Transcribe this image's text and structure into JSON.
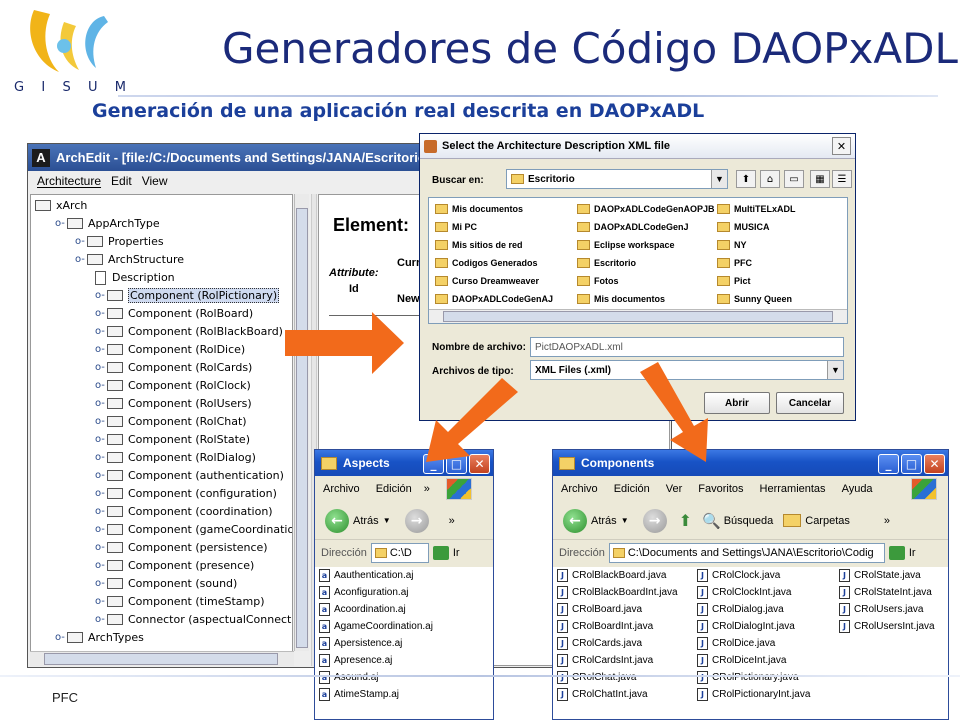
{
  "slide": {
    "title": "Generadores de Código DAOPxADL",
    "subtitle": "Generación de una aplicación real descrita en DAOPxADL",
    "footer": "PFC",
    "logo_letters": [
      "G",
      "I",
      "S",
      "U",
      "M"
    ],
    "colors": {
      "title": "#1b2a7a",
      "subtitle": "#1b3f9a",
      "arrow": "#f26a1b"
    }
  },
  "archedit": {
    "logo": "A",
    "title": "ArchEdit - [file:/C:/Documents and Settings/JANA/Escritorio",
    "menu": [
      "Architecture",
      "Edit",
      "View"
    ],
    "tree": [
      {
        "label": "xArch",
        "type": "folder",
        "sel": false
      },
      {
        "label": "AppArchType",
        "type": "folder",
        "sel": false
      },
      {
        "label": "Properties",
        "type": "folder",
        "sel": false
      },
      {
        "label": "ArchStructure",
        "type": "folder",
        "sel": false
      },
      {
        "label": "Description",
        "type": "doc",
        "sel": false
      },
      {
        "label": "Component (RolPictionary)",
        "type": "folder",
        "sel": true
      },
      {
        "label": "Component (RolBoard)",
        "type": "folder",
        "sel": false
      },
      {
        "label": "Component (RolBlackBoard)",
        "type": "folder",
        "sel": false
      },
      {
        "label": "Component (RolDice)",
        "type": "folder",
        "sel": false
      },
      {
        "label": "Component (RolCards)",
        "type": "folder",
        "sel": false
      },
      {
        "label": "Component (RolClock)",
        "type": "folder",
        "sel": false
      },
      {
        "label": "Component (RolUsers)",
        "type": "folder",
        "sel": false
      },
      {
        "label": "Component (RolChat)",
        "type": "folder",
        "sel": false
      },
      {
        "label": "Component (RolState)",
        "type": "folder",
        "sel": false
      },
      {
        "label": "Component (RolDialog)",
        "type": "folder",
        "sel": false
      },
      {
        "label": "Component (authentication)",
        "type": "folder",
        "sel": false
      },
      {
        "label": "Component (configuration)",
        "type": "folder",
        "sel": false
      },
      {
        "label": "Component (coordination)",
        "type": "folder",
        "sel": false
      },
      {
        "label": "Component (gameCoordination)",
        "type": "folder",
        "sel": false
      },
      {
        "label": "Component (persistence)",
        "type": "folder",
        "sel": false
      },
      {
        "label": "Component (presence)",
        "type": "folder",
        "sel": false
      },
      {
        "label": "Component (sound)",
        "type": "folder",
        "sel": false
      },
      {
        "label": "Component (timeStamp)",
        "type": "folder",
        "sel": false
      },
      {
        "label": "Connector (aspectualConnector)",
        "type": "folder",
        "sel": false
      },
      {
        "label": "ArchTypes",
        "type": "folder",
        "sel": false
      }
    ],
    "panel": {
      "element_label": "Element:",
      "attribute_label": "Attribute:",
      "id_label": "Id",
      "current_label": "Curr",
      "new_label": "New"
    }
  },
  "dialog": {
    "title": "Select the Architecture Description XML file",
    "lookin_label": "Buscar en:",
    "lookin_value": "Escritorio",
    "files": [
      [
        "Mis documentos",
        "DAOPxADLCodeGenAOPJB",
        "MultiTELxADL"
      ],
      [
        "Mi PC",
        "DAOPxADLCodeGenJ",
        "MUSICA"
      ],
      [
        "Mis sitios de red",
        "Eclipse workspace",
        "NY"
      ],
      [
        "Codigos Generados",
        "Escritorio",
        "PFC"
      ],
      [
        "Curso Dreamweaver",
        "Fotos",
        "Pict"
      ],
      [
        "DAOPxADLCodeGenAJ",
        "Mis documentos",
        "Sunny Queen"
      ]
    ],
    "filename_label": "Nombre de archivo:",
    "filename_value": "PictDAOPxADL.xml",
    "filetype_label": "Archivos de tipo:",
    "filetype_value": "XML Files (.xml)",
    "open_button": "Abrir",
    "cancel_button": "Cancelar"
  },
  "aspects": {
    "title": "Aspects",
    "menu": [
      "Archivo",
      "Edición"
    ],
    "more": "»",
    "back_label": "Atrás",
    "address_label": "Dirección",
    "address_value": "C:\\D",
    "go_label": "Ir",
    "files": [
      "Aauthentication.aj",
      "Aconfiguration.aj",
      "Acoordination.aj",
      "AgameCoordination.aj",
      "Apersistence.aj",
      "Apresence.aj",
      "Asound.aj",
      "AtimeStamp.aj"
    ]
  },
  "components": {
    "title": "Components",
    "menu": [
      "Archivo",
      "Edición",
      "Ver",
      "Favoritos",
      "Herramientas",
      "Ayuda"
    ],
    "more": "»",
    "back_label": "Atrás",
    "search_label": "Búsqueda",
    "folders_label": "Carpetas",
    "address_label": "Dirección",
    "address_value": "C:\\Documents and Settings\\JANA\\Escritorio\\Codig",
    "go_label": "Ir",
    "files": [
      [
        "CRolBlackBoard.java",
        "CRolClock.java",
        "CRolState.java"
      ],
      [
        "CRolBlackBoardInt.java",
        "CRolClockInt.java",
        "CRolStateInt.java"
      ],
      [
        "CRolBoard.java",
        "CRolDialog.java",
        "CRolUsers.java"
      ],
      [
        "CRolBoardInt.java",
        "CRolDialogInt.java",
        "CRolUsersInt.java"
      ],
      [
        "CRolCards.java",
        "CRolDice.java",
        ""
      ],
      [
        "CRolCardsInt.java",
        "CRolDiceInt.java",
        ""
      ],
      [
        "CRolChat.java",
        "CRolPictionary.java",
        ""
      ],
      [
        "CRolChatInt.java",
        "CRolPictionaryInt.java",
        ""
      ]
    ]
  }
}
